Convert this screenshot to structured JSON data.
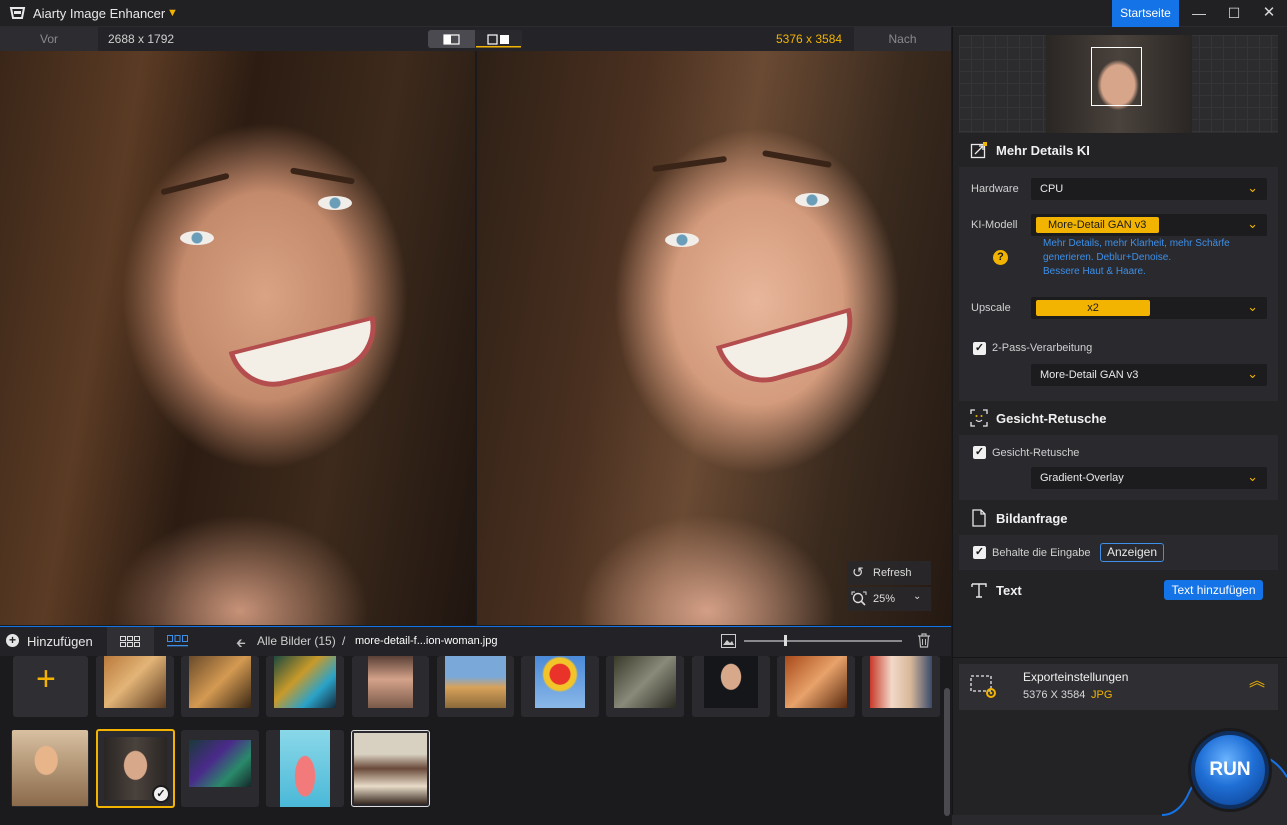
{
  "app": {
    "title": "Aiarty Image Enhancer",
    "home_button": "Startseite"
  },
  "compare": {
    "before_label": "Vor",
    "before_dims": "2688 x 1792",
    "after_dims": "5376 x 3584",
    "after_label": "Nach"
  },
  "overlay": {
    "refresh_label": "Refresh",
    "zoom_value": "25%"
  },
  "bottom_bar": {
    "add_label": "Hinzufügen",
    "breadcrumb_all": "Alle Bilder (15)",
    "breadcrumb_sep": "/",
    "breadcrumb_file": "more-detail-f...ion-woman.jpg"
  },
  "panel": {
    "section_details": "Mehr Details KI",
    "hardware_label": "Hardware",
    "hardware_value": "CPU",
    "model_label": "KI-Modell",
    "model_value": "More-Detail GAN  v3",
    "model_desc_1": "Mehr Details, mehr Klarheit, mehr Schärfe",
    "model_desc_2": "generieren. Deblur+Denoise.",
    "model_desc_3": "Bessere Haut & Haare.",
    "upscale_label": "Upscale",
    "upscale_value": "x2",
    "two_pass_label": "2-Pass-Verarbeitung",
    "two_pass_model": "More-Detail GAN  v3",
    "section_face": "Gesicht-Retusche",
    "face_check_label": "Gesicht-Retusche",
    "face_mode": "Gradient-Overlay",
    "section_prompt": "Bildanfrage",
    "keep_input_label": "Behalte die Eingabe",
    "show_button": "Anzeigen",
    "section_text": "Text",
    "add_text_button": "Text hinzufügen",
    "export_title": "Exporteinstellungen",
    "export_dims": "5376 X 3584",
    "export_format": "JPG",
    "run_button": "RUN"
  },
  "colors": {
    "accent": "#f2b400",
    "brand": "#1473e6",
    "link": "#3d8fe8"
  }
}
